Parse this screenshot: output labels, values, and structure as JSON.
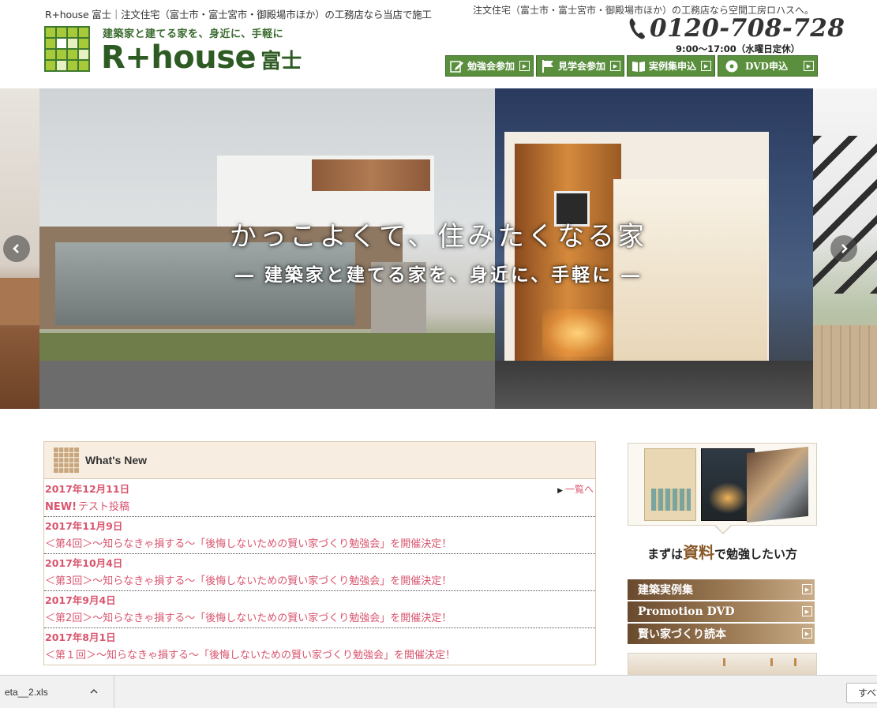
{
  "header": {
    "tagline_top": "R+house 富士｜注文住宅（富士市・富士宮市・御殿場市ほか）の工務店なら当店で施工",
    "logo_slogan": "建築家と建てる家を、身近に、手軽に",
    "logo_brand": "R+house",
    "logo_brand_sub": "富士",
    "right_text": "注文住宅（富士市・富士宮市・御殿場市ほか）の工務店なら空間工房ロハスへ。",
    "phone": "0120-708-728",
    "hours": "9:00～17:00（水曜日定休）",
    "accent_color": "#5a8f3d"
  },
  "nav_buttons": [
    {
      "label": "勉強会参加",
      "icon": "pencil-icon"
    },
    {
      "label": "見学会参加",
      "icon": "flag-icon"
    },
    {
      "label": "実例集申込",
      "icon": "book-icon"
    },
    {
      "label": "DVD申込",
      "icon": "disc-icon"
    }
  ],
  "hero": {
    "title": "かっこよくて、住みたくなる家",
    "subtitle": "― 建築家と建てる家を、身近に、手軽に ―"
  },
  "news": {
    "title": "What's New",
    "more_label": "一覧へ",
    "text_color": "#d9556e",
    "items": [
      {
        "date": "2017年12月11日",
        "badge": "NEW!",
        "text": "テスト投稿"
      },
      {
        "date": "2017年11月9日",
        "badge": "",
        "text": "＜第4回＞～知らなきゃ損する～「後悔しないための賢い家づくり勉強会」を開催決定！"
      },
      {
        "date": "2017年10月4日",
        "badge": "",
        "text": "＜第3回＞～知らなきゃ損する～「後悔しないための賢い家づくり勉強会」を開催決定！"
      },
      {
        "date": "2017年9月4日",
        "badge": "",
        "text": "＜第2回＞～知らなきゃ損する～「後悔しないための賢い家づくり勉強会」を開催決定！"
      },
      {
        "date": "2017年8月1日",
        "badge": "",
        "text": "＜第１回＞～知らなきゃ損する～「後悔しないための賢い家づくり勉強会」を開催決定！"
      }
    ]
  },
  "sidebar": {
    "caption_pre": "まずは",
    "caption_big": "資料",
    "caption_post": "で勉強したい方",
    "buttons": [
      {
        "label": "建築実例集"
      },
      {
        "label": "Promotion DVD"
      },
      {
        "label": "賢い家づくり読本"
      }
    ]
  },
  "download_bar": {
    "file_name": "eta__2.xls",
    "show_all": "すべて"
  }
}
